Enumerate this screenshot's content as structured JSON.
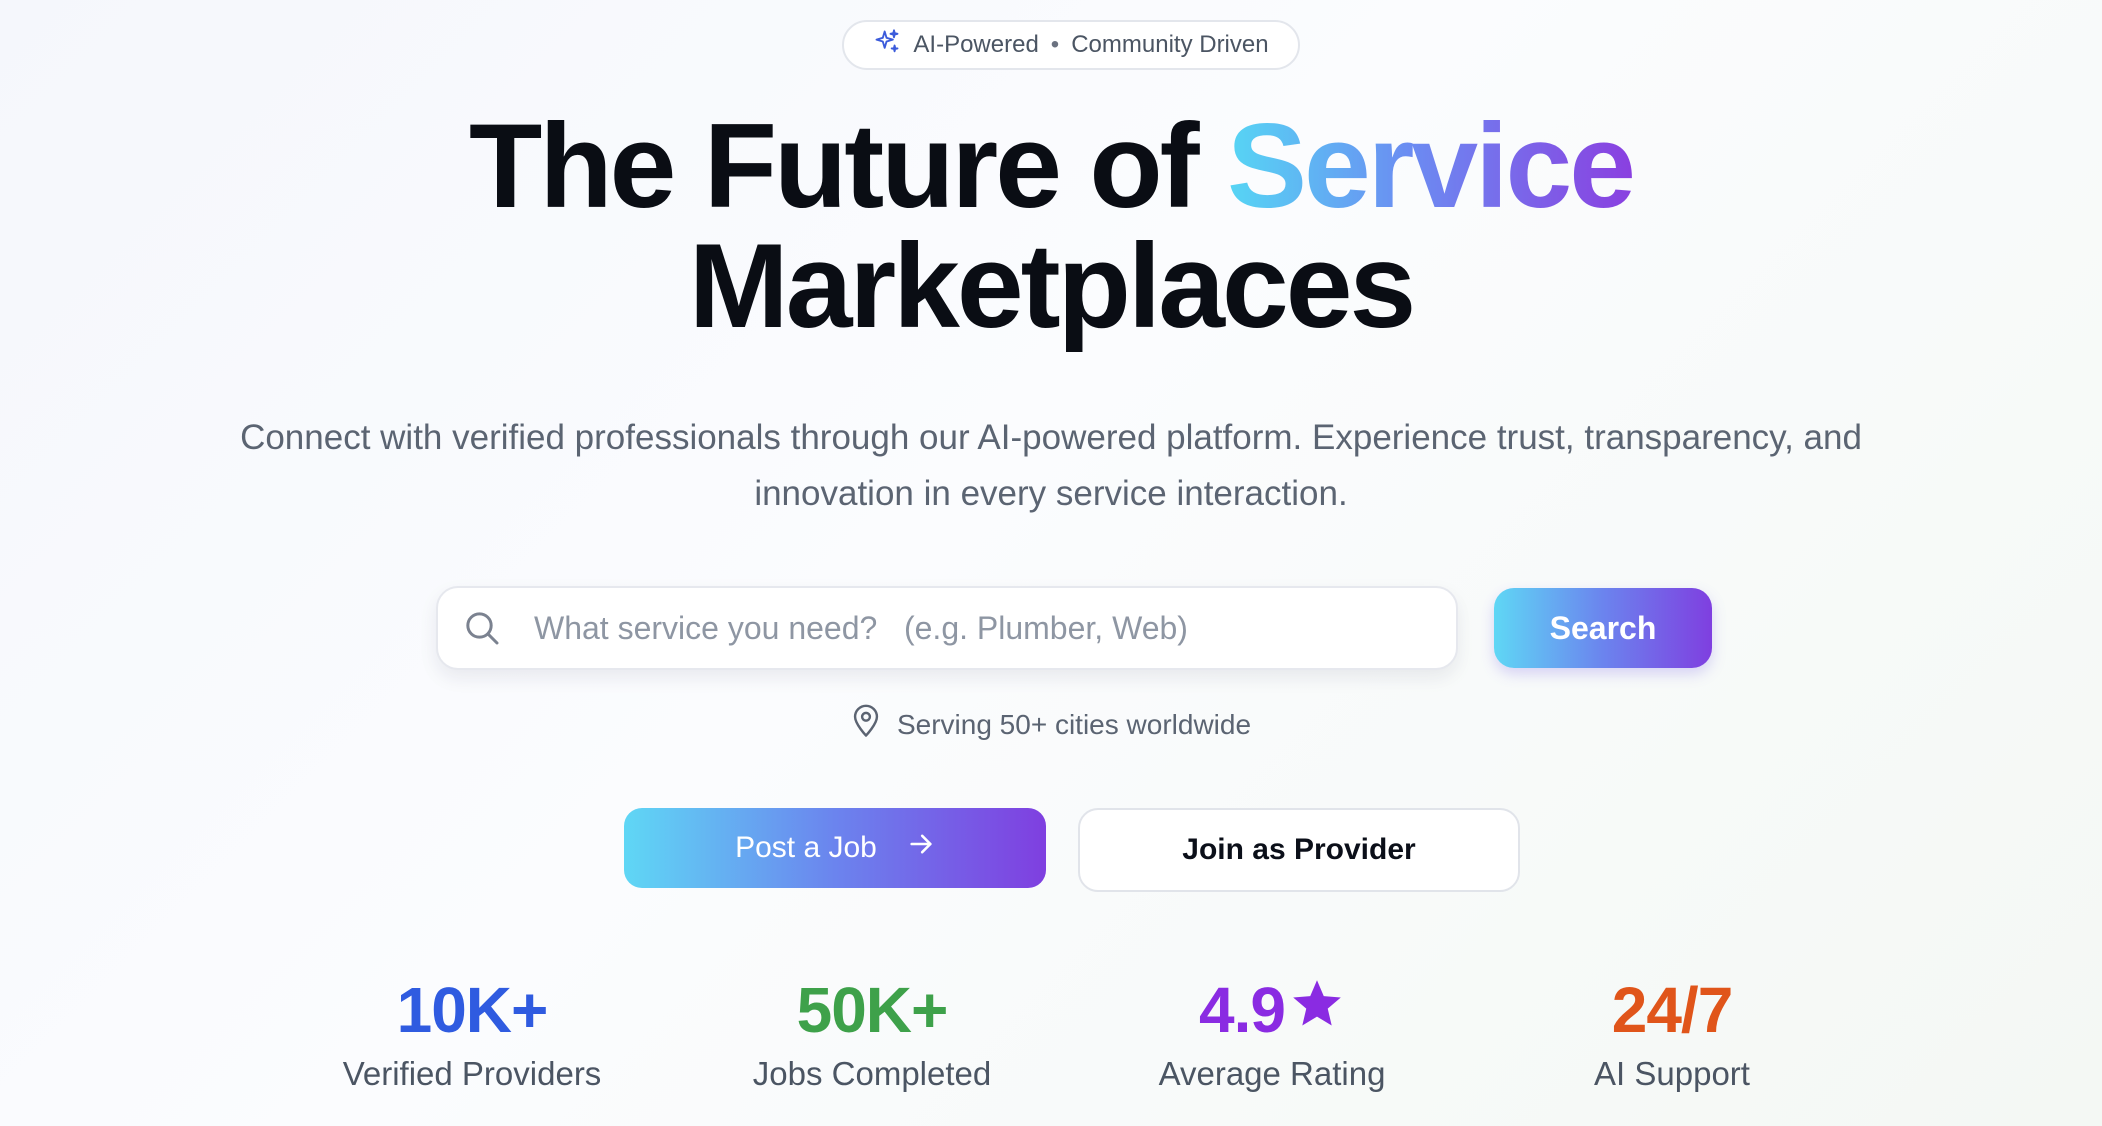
{
  "badge": {
    "text_left": "AI-Powered",
    "separator": "•",
    "text_right": "Community Driven",
    "icon": "sparkles-icon"
  },
  "hero": {
    "title_part1": "The Future of ",
    "title_highlight": "Service",
    "title_line2": "Marketplaces",
    "subtitle": "Connect with verified professionals through our AI-powered platform. Experience trust, transparency, and innovation in every service interaction."
  },
  "search": {
    "placeholder": "What service you need?   (e.g. Plumber, Web)",
    "value": "",
    "button_label": "Search",
    "icon": "search-icon"
  },
  "location": {
    "text": "Serving 50+ cities worldwide",
    "icon": "map-pin-icon"
  },
  "actions": {
    "post_job_label": "Post a Job",
    "post_job_icon": "arrow-right-icon",
    "join_provider_label": "Join as Provider"
  },
  "stats": [
    {
      "value": "10K+",
      "label": "Verified Providers",
      "color": "#2f5be0"
    },
    {
      "value": "50K+",
      "label": "Jobs Completed",
      "color": "#3ea14a"
    },
    {
      "value": "4.9",
      "label": "Average Rating",
      "color": "#8a2be2",
      "icon": "star-icon"
    },
    {
      "value": "24/7",
      "label": "AI Support",
      "color": "#e0551a"
    }
  ],
  "colors": {
    "gradient_start": "#5fd7f5",
    "gradient_mid": "#6b84ee",
    "gradient_end": "#7f3fe0"
  }
}
